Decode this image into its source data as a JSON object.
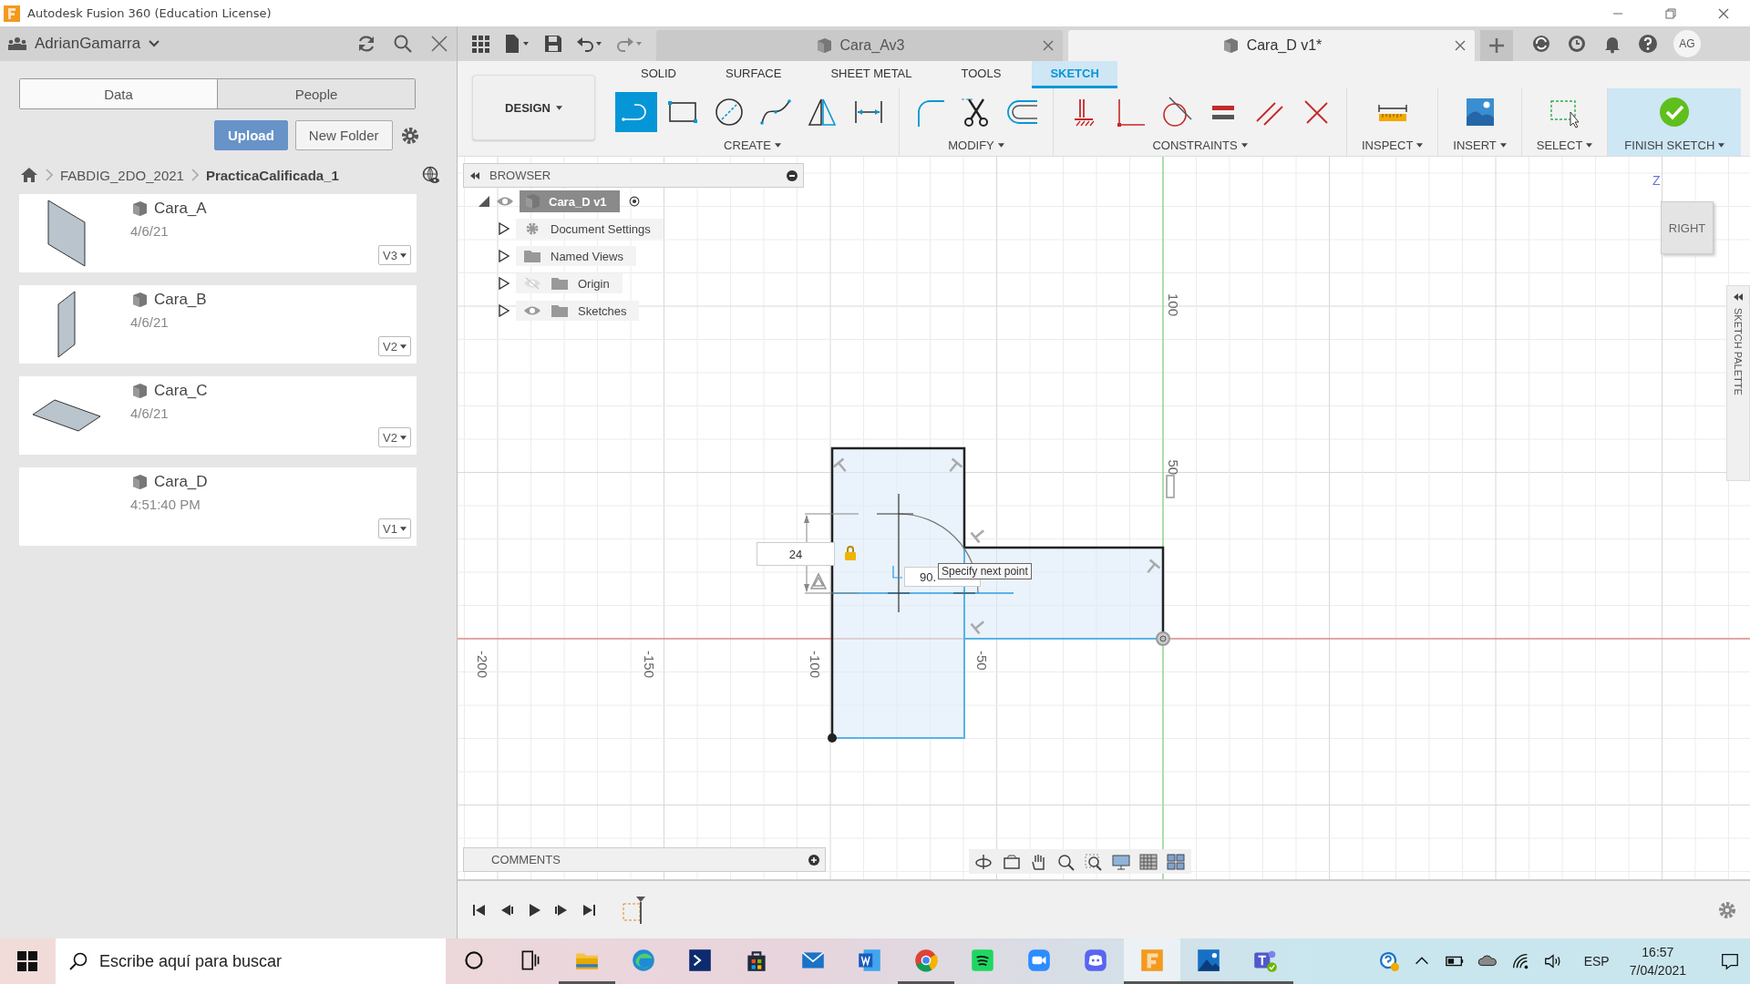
{
  "window": {
    "title": "Autodesk Fusion 360 (Education License)"
  },
  "data_panel": {
    "user": "AdrianGamarra",
    "tabs": [
      {
        "label": "Data",
        "selected": true
      },
      {
        "label": "People",
        "selected": false
      }
    ],
    "buttons": [
      {
        "label": "Upload",
        "kind": "primary"
      },
      {
        "label": "New Folder",
        "kind": "secondary"
      }
    ],
    "breadcrumb": [
      "FABDIG_2DO_2021",
      "PracticaCalificada_1"
    ],
    "files": [
      {
        "name": "Cara_A",
        "date": "4/6/21",
        "version": "V3",
        "kind": "panel"
      },
      {
        "name": "Cara_B",
        "date": "4/6/21",
        "version": "V2",
        "kind": "narrow"
      },
      {
        "name": "Cara_C",
        "date": "4/6/21",
        "version": "V2",
        "kind": "flat"
      },
      {
        "name": "Cara_D",
        "date": "4:51:40 PM",
        "version": "V1",
        "kind": "blank"
      }
    ]
  },
  "document_tabs": [
    {
      "label": "Cara_Av3",
      "selected": false
    },
    {
      "label": "Cara_D v1*",
      "selected": true
    }
  ],
  "user_initials": "AG",
  "toolbar": {
    "workspace": "DESIGN",
    "tabs": [
      {
        "label": "SOLID",
        "selected": false
      },
      {
        "label": "SURFACE",
        "selected": false
      },
      {
        "label": "SHEET METAL",
        "selected": false
      },
      {
        "label": "TOOLS",
        "selected": false
      },
      {
        "label": "SKETCH",
        "selected": true
      }
    ],
    "groups": [
      {
        "label": "CREATE",
        "kind": "normal",
        "tools": [
          {
            "kind": "line",
            "selected": true
          },
          {
            "kind": "rectangle",
            "selected": false
          },
          {
            "kind": "circle",
            "selected": false
          },
          {
            "kind": "spline",
            "selected": false
          },
          {
            "kind": "mirror",
            "selected": false
          },
          {
            "kind": "dimension",
            "selected": false
          }
        ]
      },
      {
        "label": "MODIFY",
        "kind": "normal",
        "tools": [
          {
            "kind": "fillet",
            "selected": false
          },
          {
            "kind": "trim",
            "selected": false
          },
          {
            "kind": "offset",
            "selected": false
          }
        ]
      },
      {
        "label": "CONSTRAINTS",
        "kind": "normal",
        "tools": [
          {
            "kind": "fix",
            "selected": false
          },
          {
            "kind": "coincident",
            "selected": false
          },
          {
            "kind": "tangent",
            "selected": false
          },
          {
            "kind": "equal",
            "selected": false
          },
          {
            "kind": "parallel",
            "selected": false
          },
          {
            "kind": "perpendicular",
            "selected": false
          }
        ]
      },
      {
        "label": "INSPECT",
        "kind": "normal",
        "tools": [
          {
            "kind": "measure",
            "selected": false
          }
        ]
      },
      {
        "label": "INSERT",
        "kind": "normal",
        "tools": [
          {
            "kind": "image",
            "selected": false
          }
        ]
      },
      {
        "label": "SELECT",
        "kind": "normal",
        "tools": [
          {
            "kind": "select",
            "selected": false
          }
        ]
      },
      {
        "label": "FINISH SKETCH",
        "kind": "finish",
        "tools": [
          {
            "kind": "finish",
            "selected": false
          }
        ]
      }
    ]
  },
  "browser": {
    "title": "BROWSER",
    "root": {
      "label": "Cara_D v1",
      "expanded": true,
      "children": [
        {
          "label": "Document Settings",
          "kind": "settings",
          "expanded": false
        },
        {
          "label": "Named Views",
          "kind": "folder",
          "expanded": false
        },
        {
          "label": "Origin",
          "kind": "hidden-folder",
          "expanded": false
        },
        {
          "label": "Sketches",
          "kind": "visible-folder",
          "expanded": false
        }
      ]
    }
  },
  "canvas": {
    "y_axis_labels": [
      "100",
      "50"
    ],
    "x_axis_labels": [
      "-200",
      "-150",
      "-100",
      "-50"
    ],
    "dimension": "24",
    "angle": "90.",
    "tooltip": "Specify next point",
    "viewcube": {
      "face": "RIGHT",
      "axis": "Z"
    },
    "palette": "SKETCH PALETTE"
  },
  "comments": {
    "title": "COMMENTS"
  },
  "taskbar": {
    "placeholder": "Escribe aquí para buscar",
    "apps": [
      {
        "kind": "cortana",
        "running": false,
        "selected": false
      },
      {
        "kind": "task-view",
        "running": false,
        "selected": false
      },
      {
        "kind": "explorer",
        "running": true,
        "selected": false
      },
      {
        "kind": "edge",
        "running": false,
        "selected": false
      },
      {
        "kind": "terminal",
        "running": false,
        "selected": false
      },
      {
        "kind": "store",
        "running": false,
        "selected": false
      },
      {
        "kind": "mail",
        "running": false,
        "selected": false
      },
      {
        "kind": "word",
        "running": false,
        "selected": false
      },
      {
        "kind": "chrome",
        "running": true,
        "selected": false
      },
      {
        "kind": "spotify",
        "running": false,
        "selected": false
      },
      {
        "kind": "zoom",
        "running": false,
        "selected": false
      },
      {
        "kind": "discord",
        "running": false,
        "selected": false
      },
      {
        "kind": "fusion",
        "running": true,
        "selected": true
      },
      {
        "kind": "photos",
        "running": true,
        "selected": false
      },
      {
        "kind": "teams",
        "running": true,
        "selected": false
      }
    ],
    "language": "ESP",
    "time": "16:57",
    "date": "7/04/2021"
  }
}
